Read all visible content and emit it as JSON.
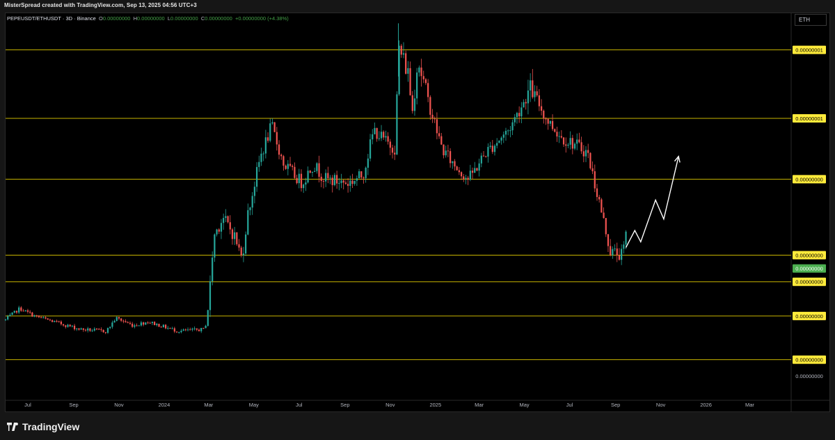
{
  "header": {
    "credit": "MisterSpread created with TradingView.com, Sep 13, 2025 04:56 UTC+3"
  },
  "legend": {
    "symbol": "PEPEUSDT/ETHUSDT · 3D · Binance",
    "o_label": "O",
    "o_value": "0.00000000",
    "h_label": "H",
    "h_value": "0.00000000",
    "l_label": "L",
    "l_value": "0.00000000",
    "c_label": "C",
    "c_value": "0.00000000",
    "change": "+0.00000000 (+4.38%)"
  },
  "currency_button": "ETH",
  "brand": "TradingView",
  "colors": {
    "up": "#26a69a",
    "down": "#ef5350",
    "level_line": "#c8b400",
    "level_label_bg": "#ffeb3b",
    "current_price_bg": "#4caf50",
    "projection": "#ffffff"
  },
  "chart_data": {
    "type": "candlestick",
    "xlabel": "",
    "ylabel": "",
    "x_tick_labels": [
      "Jul",
      "Sep",
      "Nov",
      "2024",
      "Mar",
      "May",
      "Jul",
      "Sep",
      "Nov",
      "2025",
      "Mar",
      "May",
      "Jul",
      "Sep",
      "Nov",
      "2026",
      "Mar"
    ],
    "y_axis_labels": [
      "0.00000001",
      "0.00000001",
      "0.00000000",
      "0.00000000",
      "0.00000000",
      "0.00000000",
      "0.00000000",
      "0.00000000"
    ],
    "current_price_label": "0.00000000",
    "horizontal_levels_rel": [
      0.92,
      0.74,
      0.58,
      0.38,
      0.31,
      0.22,
      0.105
    ],
    "price_anchors_rel": [
      [
        "2023-06-01",
        0.21
      ],
      [
        "2023-06-20",
        0.24
      ],
      [
        "2023-07-10",
        0.22
      ],
      [
        "2023-08-05",
        0.205
      ],
      [
        "2023-09-10",
        0.185
      ],
      [
        "2023-10-15",
        0.18
      ],
      [
        "2023-10-28",
        0.215
      ],
      [
        "2023-11-20",
        0.195
      ],
      [
        "2023-12-10",
        0.205
      ],
      [
        "2024-01-20",
        0.18
      ],
      [
        "2024-02-25",
        0.185
      ],
      [
        "2024-03-01",
        0.25
      ],
      [
        "2024-03-08",
        0.43
      ],
      [
        "2024-03-20",
        0.48
      ],
      [
        "2024-04-05",
        0.43
      ],
      [
        "2024-04-15",
        0.37
      ],
      [
        "2024-04-22",
        0.48
      ],
      [
        "2024-05-10",
        0.64
      ],
      [
        "2024-05-25",
        0.72
      ],
      [
        "2024-06-10",
        0.62
      ],
      [
        "2024-07-05",
        0.57
      ],
      [
        "2024-07-20",
        0.62
      ],
      [
        "2024-08-05",
        0.58
      ],
      [
        "2024-09-05",
        0.57
      ],
      [
        "2024-09-25",
        0.59
      ],
      [
        "2024-10-10",
        0.71
      ],
      [
        "2024-10-25",
        0.68
      ],
      [
        "2024-11-08",
        0.66
      ],
      [
        "2024-11-12",
        0.93
      ],
      [
        "2024-11-25",
        0.86
      ],
      [
        "2024-12-01",
        0.76
      ],
      [
        "2024-12-08",
        0.9
      ],
      [
        "2024-12-20",
        0.8
      ],
      [
        "2025-01-10",
        0.66
      ],
      [
        "2025-01-25",
        0.62
      ],
      [
        "2025-02-15",
        0.58
      ],
      [
        "2025-03-10",
        0.65
      ],
      [
        "2025-04-10",
        0.71
      ],
      [
        "2025-05-10",
        0.82
      ],
      [
        "2025-05-30",
        0.74
      ],
      [
        "2025-06-20",
        0.69
      ],
      [
        "2025-07-10",
        0.67
      ],
      [
        "2025-07-25",
        0.65
      ],
      [
        "2025-08-10",
        0.52
      ],
      [
        "2025-08-25",
        0.39
      ],
      [
        "2025-09-10",
        0.38
      ],
      [
        "2025-09-15",
        0.43
      ]
    ],
    "projection_rel": [
      [
        "2025-09-15",
        0.4
      ],
      [
        "2025-09-27",
        0.445
      ],
      [
        "2025-10-05",
        0.415
      ],
      [
        "2025-10-25",
        0.525
      ],
      [
        "2025-11-05",
        0.475
      ],
      [
        "2025-11-25",
        0.64
      ]
    ]
  }
}
